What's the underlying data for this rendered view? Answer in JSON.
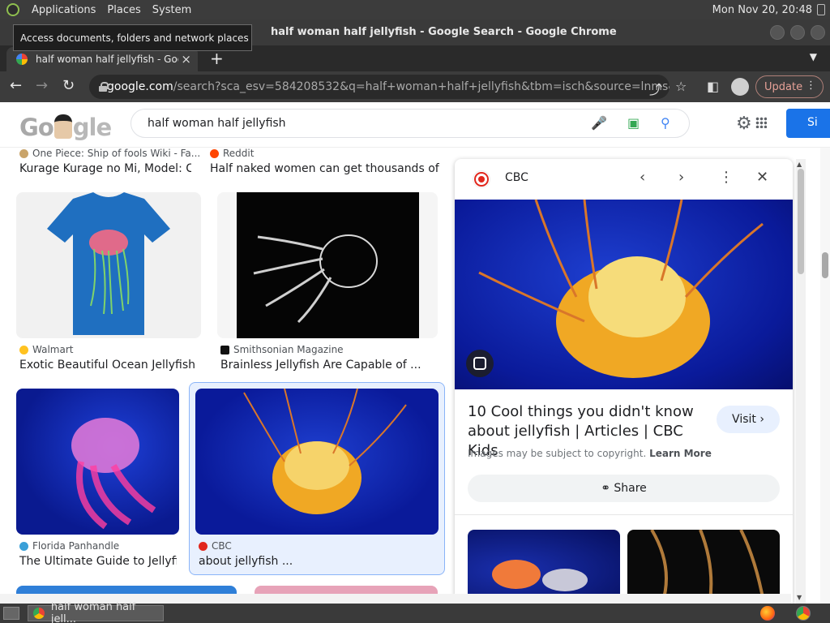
{
  "os": {
    "menus": [
      "Applications",
      "Places",
      "System"
    ],
    "clock": "Mon Nov 20, 20:48",
    "tooltip": "Access documents, folders and network places"
  },
  "window": {
    "title": "half woman half jellyfish - Google Search - Google Chrome"
  },
  "tab": {
    "label": "half woman half jellyfish - Goo",
    "close_icon": "×",
    "new_tab_icon": "+"
  },
  "toolbar": {
    "url_host": "google.com",
    "url_path": "/search?sca_esv=584208532&q=half+woman+half+jellyfish&tbm=isch&source=lnms&sa=...",
    "update_label": "Update"
  },
  "google": {
    "logo_text": "Google",
    "query": "half woman half jellyfish",
    "signin_label": "Si"
  },
  "results": [
    {
      "source": "One Piece: Ship of fools Wiki - Fa...",
      "title": "Kurage Kurage no Mi, Model: C...",
      "fav_color": "#c9a46a"
    },
    {
      "source": "Reddit",
      "title": "Half naked women can get thousands of ...",
      "fav_color": "#ff4500"
    },
    {
      "source": "Walmart",
      "title": "Exotic Beautiful Ocean Jellyfish ...",
      "fav_color": "#ffc220"
    },
    {
      "source": "Smithsonian Magazine",
      "title": "Brainless Jellyfish Are Capable of ...",
      "fav_color": "#111111"
    },
    {
      "source": "Florida Panhandle",
      "title": "The Ultimate Guide to Jellyfi...",
      "fav_color": "#3aa0d8"
    },
    {
      "source": "CBC",
      "title": "about jellyfish ...",
      "fav_color": "#e1261c"
    }
  ],
  "panel": {
    "source": "CBC",
    "title": "10 Cool things you didn't know about jellyfish | Articles | CBC Kids",
    "visit_label": "Visit",
    "copyright_text": "Images may be subject to copyright.",
    "learn_more": "Learn More",
    "share_label": "Share"
  },
  "taskbar": {
    "task_label": "half woman half jell..."
  }
}
